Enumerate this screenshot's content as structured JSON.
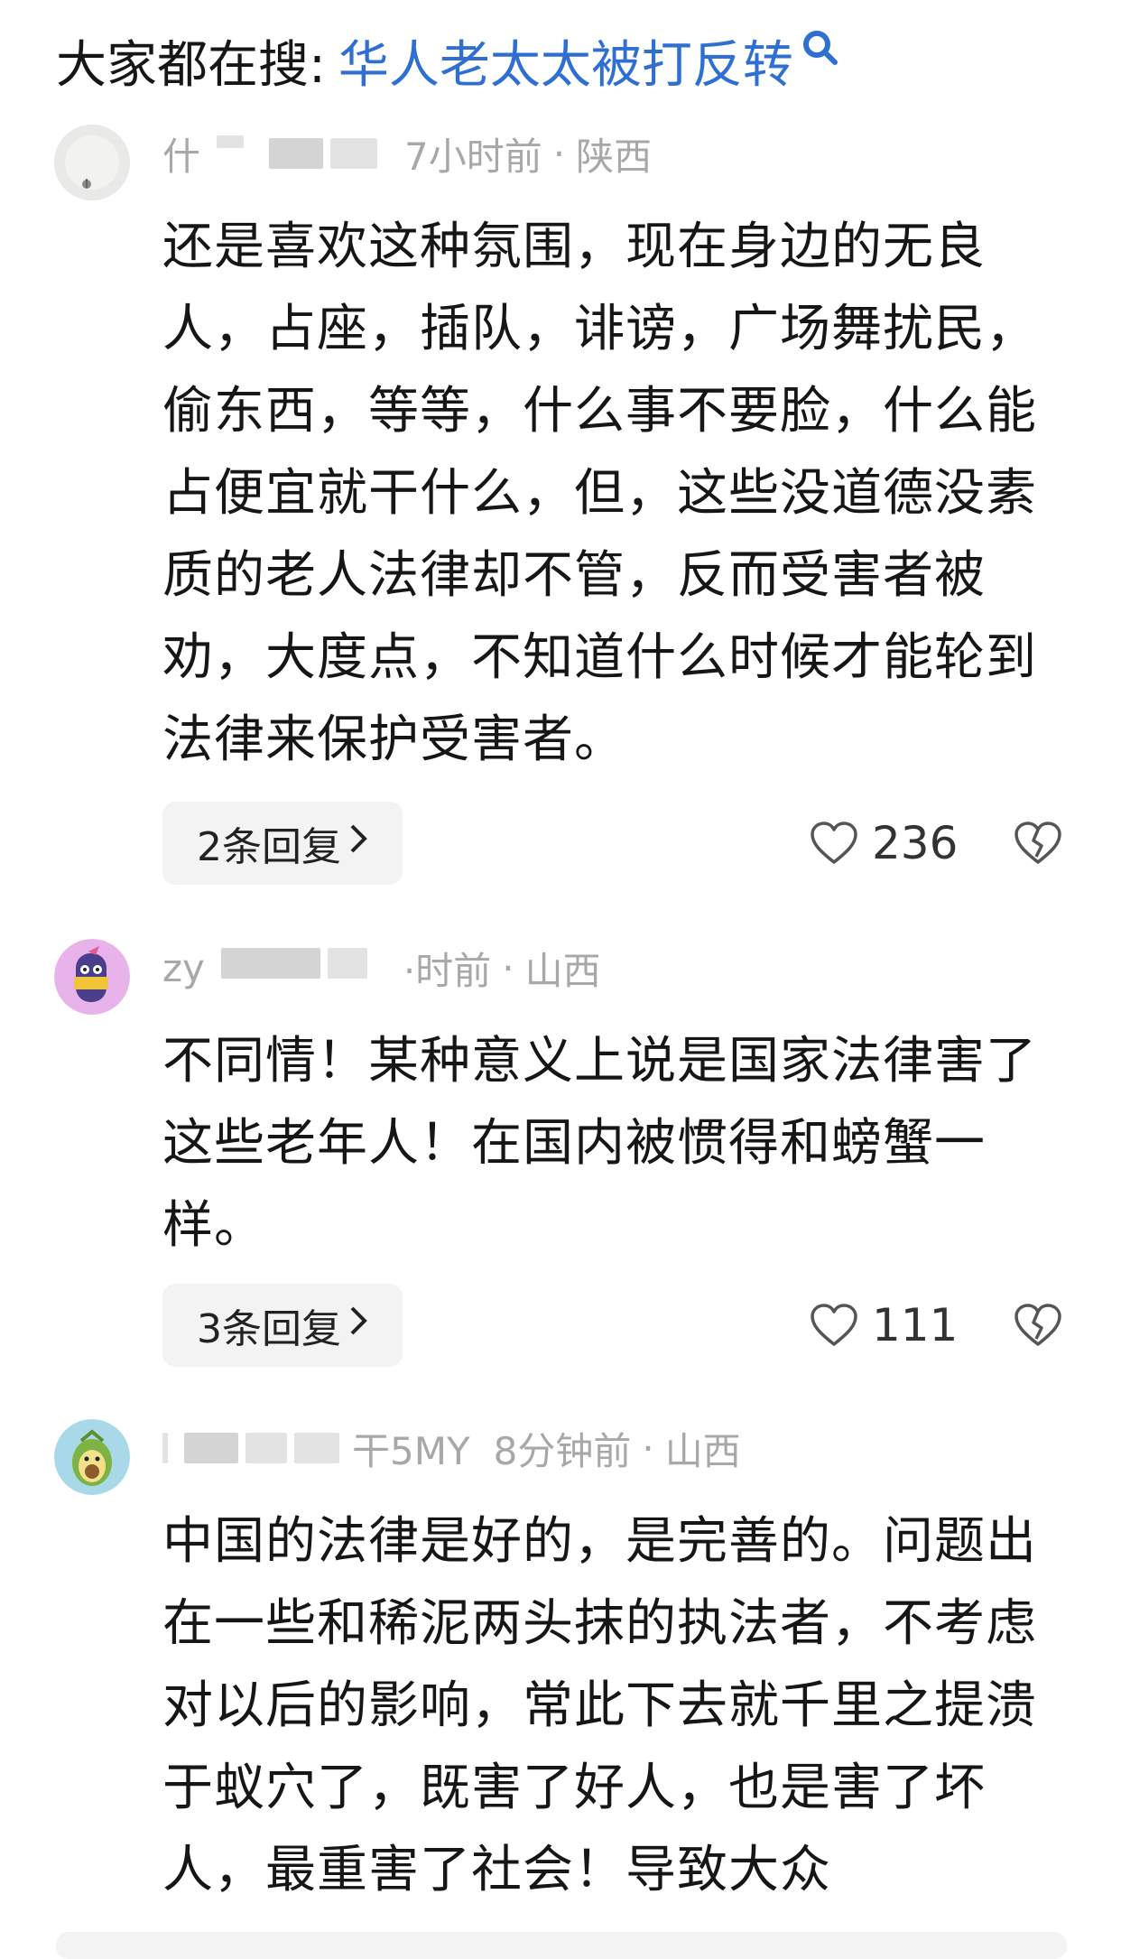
{
  "search": {
    "prefix": "大家都在搜:",
    "query": "华人老太太被打反转"
  },
  "comments": [
    {
      "user_prefix": "什",
      "user_suffix": "",
      "time": "7小时前",
      "location": "陕西",
      "dot": "·",
      "body": "还是喜欢这种氛围，现在身边的无良人，占座，插队，诽谤，广场舞扰民，偷东西，等等，什么事不要脸，什么能占便宜就干什么，但，这些没道德没素质的老人法律却不管，反而受害者被劝，大度点，不知道什么时候才能轮到法律来保护受害者。",
      "replies": "2条回复",
      "likes": "236"
    },
    {
      "user_prefix": "zy",
      "user_suffix": "",
      "time": "·时前",
      "location": "山西",
      "dot": "·",
      "body": "不同情！某种意义上说是国家法律害了这些老年人！在国内被惯得和螃蟹一样。",
      "replies": "3条回复",
      "likes": "111"
    },
    {
      "user_prefix": "",
      "user_suffix": "干5MY",
      "time": "8分钟前",
      "location": "山西",
      "dot": "·",
      "body": "中国的法律是好的，是完善的。问题出在一些和稀泥两头抹的执法者，不考虑对以后的影响，常此下去就千里之提溃于蚁穴了，既害了好人，也是害了坏人，最重害了社会！导致大众",
      "replies": "",
      "likes": ""
    }
  ],
  "icons": {
    "search": "search-icon",
    "like": "heart-outline-icon",
    "dislike": "broken-heart-icon",
    "chevron": "chevron-right-icon"
  },
  "colors": {
    "accent": "#2f6fd2",
    "meta": "#a8a8a8",
    "text": "#161616",
    "reply_bg": "#f3f3f3"
  }
}
